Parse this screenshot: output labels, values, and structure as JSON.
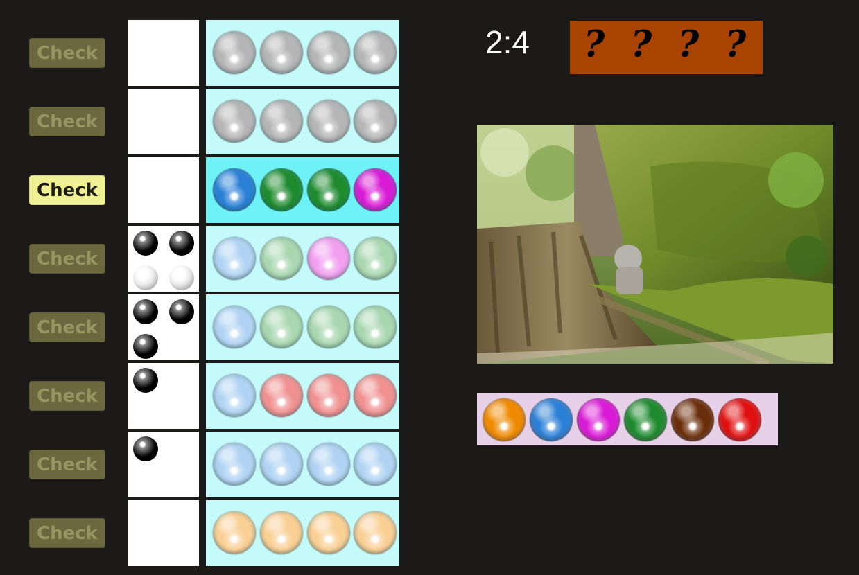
{
  "game": {
    "score_text": "2:4"
  },
  "secret": {
    "marks": [
      "?",
      "?",
      "?",
      "?"
    ],
    "background": "#a84300"
  },
  "colors": {
    "gray": "#b5b5b5",
    "blue": "#2a7fd6",
    "green": "#1e8a2e",
    "magenta": "#d91ad6",
    "orange": "#ef8a00",
    "brown": "#6b2e0a",
    "red": "#e01010",
    "lightblue": "#b0d3f3",
    "lightgreen": "#a9d7b0",
    "lightpink": "#f29ff0",
    "lightred": "#f09090",
    "lightorange": "#f9cf94"
  },
  "rows": [
    {
      "button_label": "Check",
      "active": false,
      "pegs": [],
      "balls": [
        "gray",
        "gray",
        "gray",
        "gray"
      ]
    },
    {
      "button_label": "Check",
      "active": false,
      "pegs": [],
      "balls": [
        "gray",
        "gray",
        "gray",
        "gray"
      ]
    },
    {
      "button_label": "Check",
      "active": true,
      "pegs": [],
      "balls": [
        "blue",
        "green",
        "green",
        "magenta"
      ]
    },
    {
      "button_label": "Check",
      "active": false,
      "pegs": [
        "black",
        "black",
        "white",
        "white"
      ],
      "balls": [
        "lightblue",
        "lightgreen",
        "lightpink",
        "lightgreen"
      ]
    },
    {
      "button_label": "Check",
      "active": false,
      "pegs": [
        "black",
        "black",
        "black"
      ],
      "balls": [
        "lightblue",
        "lightgreen",
        "lightgreen",
        "lightgreen"
      ]
    },
    {
      "button_label": "Check",
      "active": false,
      "pegs": [
        "black"
      ],
      "balls": [
        "lightblue",
        "lightred",
        "lightred",
        "lightred"
      ]
    },
    {
      "button_label": "Check",
      "active": false,
      "pegs": [
        "black"
      ],
      "balls": [
        "lightblue",
        "lightblue",
        "lightblue",
        "lightblue"
      ]
    },
    {
      "button_label": "Check",
      "active": false,
      "pegs": [],
      "balls": [
        "lightorange",
        "lightorange",
        "lightorange",
        "lightorange"
      ]
    }
  ],
  "palette": [
    "orange",
    "blue",
    "magenta",
    "green",
    "brown",
    "red"
  ]
}
